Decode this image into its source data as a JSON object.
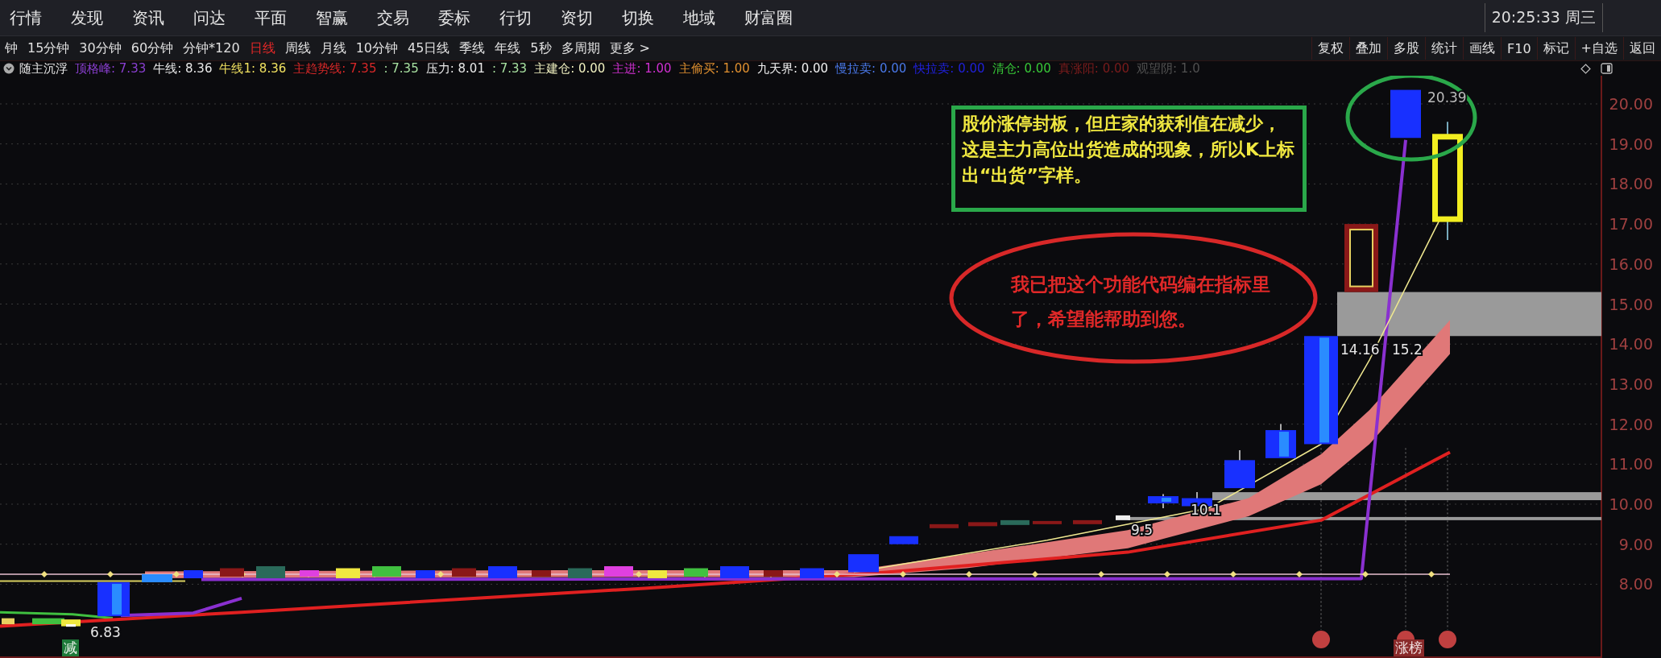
{
  "menu_bar": {
    "items": [
      "行情",
      "发现",
      "资讯",
      "问达",
      "平面",
      "智赢",
      "交易",
      "委标",
      "行切",
      "资切",
      "切换",
      "地域",
      "财富圈"
    ],
    "clock": "20:25:33 周三"
  },
  "period_bar": {
    "periods": [
      {
        "label": "钟",
        "selected": false
      },
      {
        "label": "15分钟",
        "selected": false
      },
      {
        "label": "30分钟",
        "selected": false
      },
      {
        "label": "60分钟",
        "selected": false
      },
      {
        "label": "分钟*120",
        "selected": false
      },
      {
        "label": "日线",
        "selected": true
      },
      {
        "label": "周线",
        "selected": false
      },
      {
        "label": "月线",
        "selected": false
      },
      {
        "label": "10分钟",
        "selected": false
      },
      {
        "label": "45日线",
        "selected": false
      },
      {
        "label": "季线",
        "selected": false
      },
      {
        "label": "年线",
        "selected": false
      },
      {
        "label": "5秒",
        "selected": false
      },
      {
        "label": "多周期",
        "selected": false
      },
      {
        "label": "更多 >",
        "selected": false
      }
    ],
    "tools": [
      "复权",
      "叠加",
      "多股",
      "统计",
      "画线",
      "F10",
      "标记",
      "+自选",
      "返回"
    ]
  },
  "indicator_bar": {
    "name": "随主沉浮",
    "values": [
      {
        "text": "顶格峰: 7.33",
        "color": "#8a3fd0"
      },
      {
        "text": "牛线: 8.36",
        "color": "#e8e8e8"
      },
      {
        "text": "牛线1: 8.36",
        "color": "#f0e060"
      },
      {
        "text": "主趋势线: 7.35",
        "color": "#d82828"
      },
      {
        "text": ": 7.35",
        "color": "#a8e0a0"
      },
      {
        "text": "压力: 8.01",
        "color": "#e8e8e8"
      },
      {
        "text": ": 7.33",
        "color": "#a8e0a0"
      },
      {
        "text": "主建仓: 0.00",
        "color": "#f0f0c0"
      },
      {
        "text": "主进: 1.00",
        "color": "#d030d0"
      },
      {
        "text": "主偷买: 1.00",
        "color": "#e09030"
      },
      {
        "text": "九天界: 0.00",
        "color": "#f0f0f0"
      },
      {
        "text": "慢拉卖: 0.00",
        "color": "#4a78e8"
      },
      {
        "text": "快拉卖: 0.00",
        "color": "#2020d8"
      },
      {
        "text": "清仓: 0.00",
        "color": "#38c838"
      },
      {
        "text": "真涨阳: 0.00",
        "color": "#7a1c1c"
      },
      {
        "text": "观望阴: 1.0",
        "color": "#505050"
      }
    ]
  },
  "chart": {
    "price_axis": [
      "20.00",
      "19.00",
      "18.00",
      "17.00",
      "16.00",
      "15.00",
      "14.00",
      "13.00",
      "12.00",
      "11.00",
      "10.00",
      "9.00",
      "8.00"
    ],
    "price_labels": [
      "20.39",
      "14.16",
      "15.2",
      "10.1",
      "9.5",
      "6.83"
    ],
    "signals": [
      {
        "text": "减",
        "kind": "reduce"
      },
      {
        "text": "涨榜",
        "kind": "limit"
      }
    ],
    "notes": [
      {
        "kind": "box",
        "text": "股价涨停封板，但庄家的获利值在减少，这是主力高位出货造成的现象，所以K上标出“出货”字样。"
      },
      {
        "kind": "ellipse",
        "text": "我已把这个功能代码编在指标里了，希望能帮助到您。"
      }
    ]
  }
}
